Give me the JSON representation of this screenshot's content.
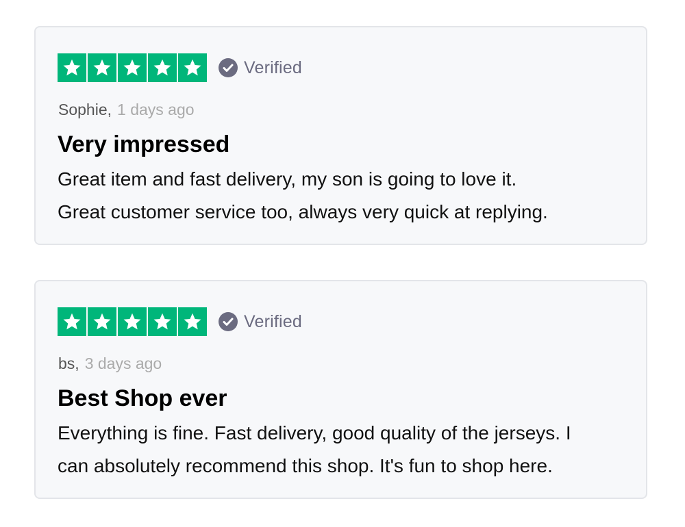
{
  "colors": {
    "star_green": "#00b67a",
    "verified_gray": "#6b6b80",
    "card_background": "#f7f8fa",
    "card_border": "#e3e5e9"
  },
  "reviews": [
    {
      "rating": 5,
      "verified_label": "Verified",
      "reviewer": "Sophie,",
      "date": "1 days ago",
      "title": "Very impressed",
      "body_lines": [
        "Great item and fast delivery, my son is going to love it.",
        "Great customer service too, always very quick at replying."
      ]
    },
    {
      "rating": 5,
      "verified_label": "Verified",
      "reviewer": "bs,",
      "date": "3 days ago",
      "title": "Best Shop ever",
      "body_lines": [
        "Everything is fine. Fast delivery, good quality of the jerseys. I",
        "can absolutely recommend this shop. It's fun to shop here."
      ]
    }
  ]
}
